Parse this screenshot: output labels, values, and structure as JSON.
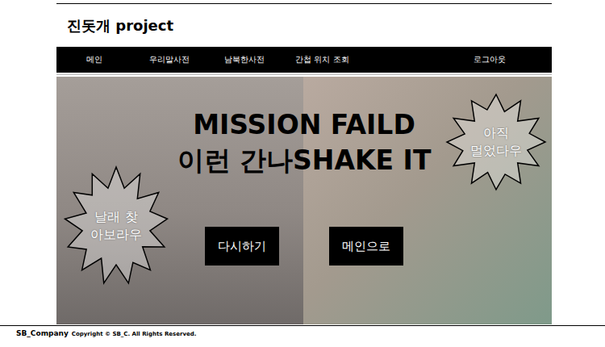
{
  "site": {
    "title": "진돗개 project"
  },
  "nav": {
    "items": [
      "메인",
      "우리말사전",
      "남북한사전",
      "간첩 위치 조회"
    ],
    "logout": "로그아웃"
  },
  "banner": {
    "headline": "MISSION FAILD",
    "subline": "이런 간나SHAKE IT",
    "bursts": [
      {
        "lines": [
          "날래 찾",
          "아보라우"
        ]
      },
      {
        "lines": [
          "아직",
          "멀었다우"
        ]
      }
    ],
    "buttons": [
      "다시하기",
      "메인으로"
    ]
  },
  "footer": {
    "brand": "SB_Company",
    "copyright": "Copyright © SB_C. All Rights Reserved."
  }
}
